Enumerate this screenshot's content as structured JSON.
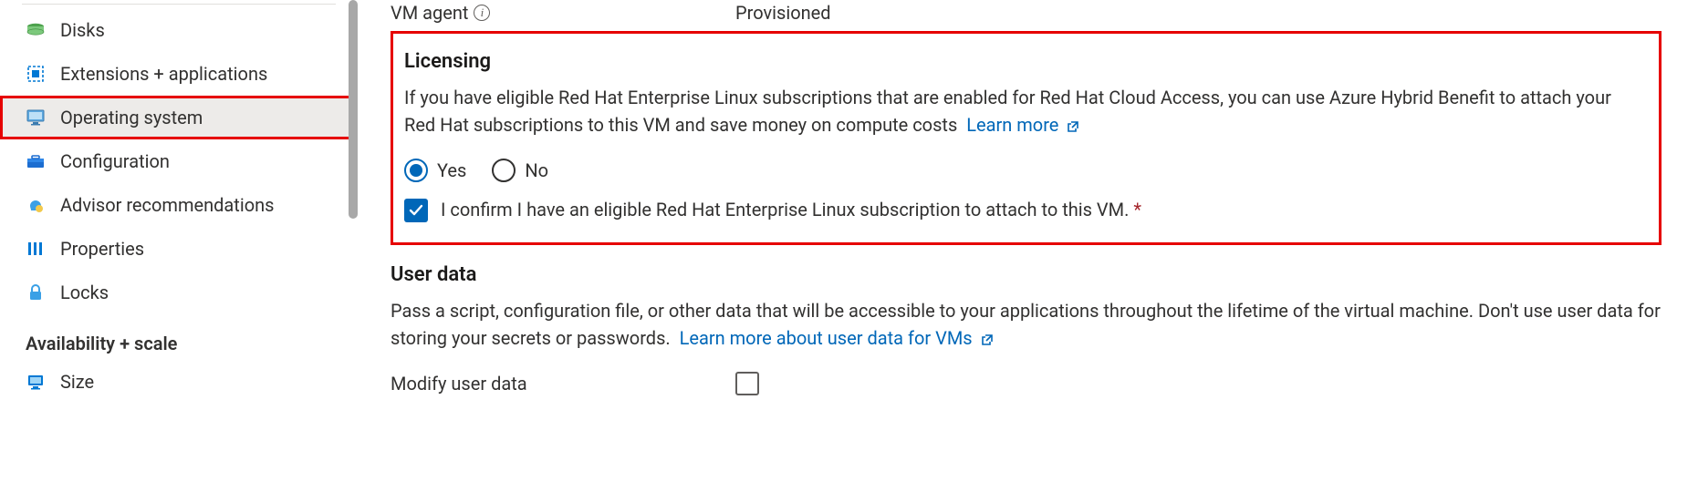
{
  "sidebar": {
    "items": [
      {
        "label": "Disks"
      },
      {
        "label": "Extensions + applications"
      },
      {
        "label": "Operating system"
      },
      {
        "label": "Configuration"
      },
      {
        "label": "Advisor recommendations"
      },
      {
        "label": "Properties"
      },
      {
        "label": "Locks"
      }
    ],
    "section_header": "Availability + scale",
    "section_items": [
      {
        "label": "Size"
      }
    ]
  },
  "main": {
    "vm_agent": {
      "key": "VM agent",
      "value": "Provisioned"
    },
    "licensing": {
      "title": "Licensing",
      "description": "If you have eligible Red Hat Enterprise Linux subscriptions that are enabled for Red Hat Cloud Access, you can use Azure Hybrid Benefit to attach your Red Hat subscriptions to this VM and save money on compute costs",
      "learn_more": "Learn more",
      "option_yes": "Yes",
      "option_no": "No",
      "confirm_text": "I confirm I have an eligible Red Hat Enterprise Linux subscription to attach to this VM.",
      "required_mark": "*"
    },
    "user_data": {
      "title": "User data",
      "description_pre": "Pass a script, configuration file, or other data that will be accessible to your applications throughout the lifetime of the virtual machine. Don't use user data for storing your secrets or passwords.",
      "learn_more": "Learn more about user data for VMs",
      "modify_label": "Modify user data"
    }
  }
}
